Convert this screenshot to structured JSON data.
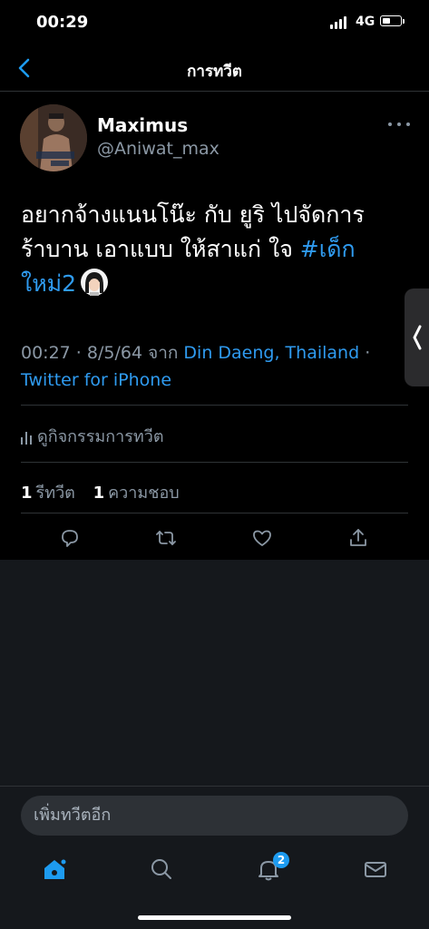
{
  "status_bar": {
    "time": "00:29",
    "network": "4G"
  },
  "nav": {
    "title": "การทวีต"
  },
  "tweet": {
    "author_name": "Maximus",
    "author_handle": "@Aniwat_max",
    "line1": "อยากจ้างแนนโน๊ะ กับ ยูริ  ไปจัดการ",
    "line2_text": "ร้าบาน  เอาแบบ ให้สาแก่ ใจ ",
    "hashtag_part1": "#เด็ก",
    "hashtag_part2": "ใหม่2",
    "time": "00:27 · 8/5/64 จาก ",
    "location": "Din Daeng, Thailand",
    "separator": " ·",
    "source": "Twitter for iPhone"
  },
  "activity": {
    "label": "ดูกิจกรรมการทวีต"
  },
  "stats": {
    "retweets_count": "1",
    "retweets_label": "รีทวีต",
    "likes_count": "1",
    "likes_label": "ความชอบ"
  },
  "compose": {
    "placeholder": "เพิ่มทวีตอีก"
  },
  "tabbar": {
    "notifications_badge": "2"
  },
  "colors": {
    "accent": "#1d9bf0",
    "background": "#000000",
    "secondary_text": "#8b98a5"
  }
}
